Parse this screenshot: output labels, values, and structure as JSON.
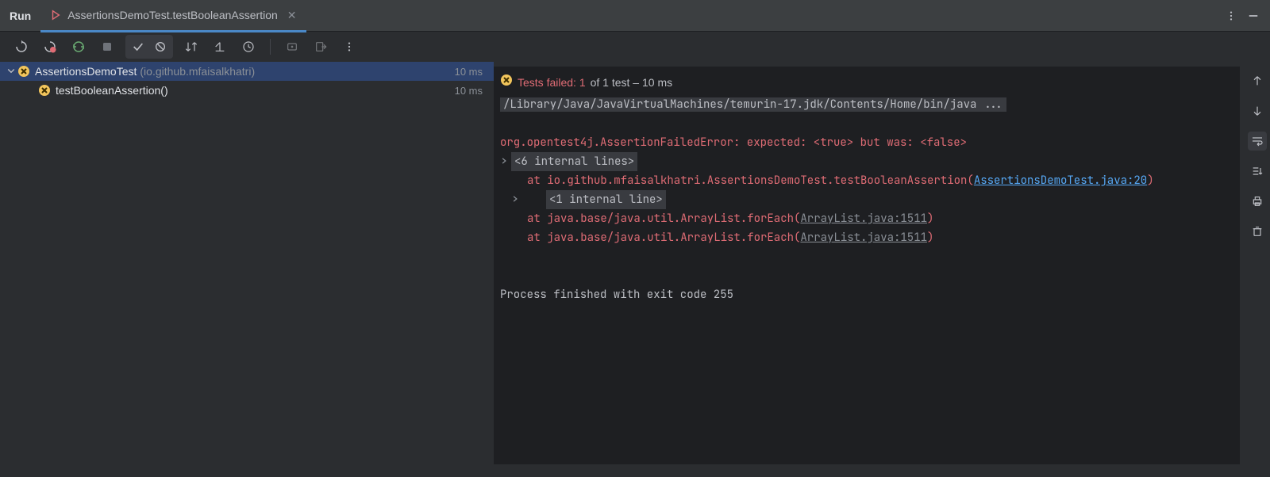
{
  "titlebar": {
    "run_label": "Run",
    "tab_title": "AssertionsDemoTest.testBooleanAssertion"
  },
  "tree": {
    "root": {
      "name": "AssertionsDemoTest",
      "package": "(io.github.mfaisalkhatri)",
      "duration": "10 ms"
    },
    "child": {
      "name": "testBooleanAssertion()",
      "duration": "10 ms"
    }
  },
  "console": {
    "status_prefix": "Tests failed: 1",
    "status_suffix": " of 1 test – 10 ms",
    "command_line": "/Library/Java/JavaVirtualMachines/temurin-17.jdk/Contents/Home/bin/java ...",
    "error_line": "org.opentest4j.AssertionFailedError: expected: <true> but was: <false>",
    "internal_6": "<6 internal lines>",
    "at1_prefix": "at io.github.mfaisalkhatri.AssertionsDemoTest.testBooleanAssertion(",
    "at1_link": "AssertionsDemoTest.java:20",
    "at1_suffix": ")",
    "internal_1": "<1 internal line>",
    "at2_prefix": "at java.base/java.util.ArrayList.forEach(",
    "at2_link": "ArrayList.java:1511",
    "at2_suffix": ")",
    "at3_prefix": "at java.base/java.util.ArrayList.forEach(",
    "at3_link": "ArrayList.java:1511",
    "at3_suffix": ")",
    "exit": "Process finished with exit code 255"
  },
  "colors": {
    "fail_red": "#e06c75",
    "link_blue": "#56a8f5",
    "bg_dark": "#1e1f22",
    "bg_panel": "#2b2d30",
    "selection": "#2e436e"
  }
}
